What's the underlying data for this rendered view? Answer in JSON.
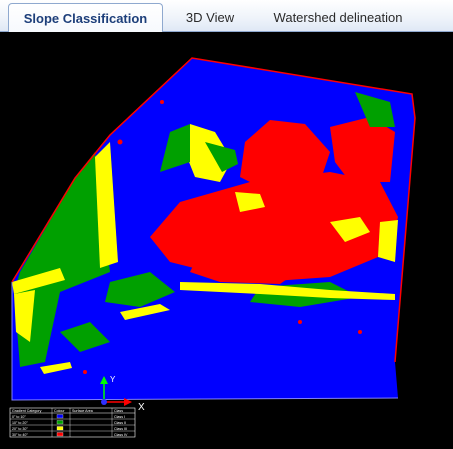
{
  "tabs": [
    {
      "label": "Slope Classification",
      "active": true
    },
    {
      "label": "3D View",
      "active": false
    },
    {
      "label": "Watershed delineation",
      "active": false
    }
  ],
  "colors": {
    "background": "#000000",
    "slope_low": "#0000ff",
    "slope_medium": "#00a000",
    "slope_high": "#ffff00",
    "slope_very_high": "#ff0000",
    "axis_y": "#00ff00",
    "axis_x": "#ff0000",
    "tab_accent": "#1d3f7a"
  },
  "axes": {
    "y_label": "Y",
    "x_label": "X"
  },
  "legend": {
    "headers": [
      "Gradient Category",
      "Colour",
      "Surface Area",
      "Class"
    ],
    "rows": [
      {
        "category": "0° to 10°",
        "color": "#0000ff",
        "area": "",
        "class": "Class I"
      },
      {
        "category": "10° to 20°",
        "color": "#00a000",
        "area": "",
        "class": "Class II"
      },
      {
        "category": "20° to 30°",
        "color": "#ffff00",
        "area": "",
        "class": "Class III"
      },
      {
        "category": "30° to 40°",
        "color": "#ff0000",
        "area": "",
        "class": "Class IV"
      }
    ]
  }
}
